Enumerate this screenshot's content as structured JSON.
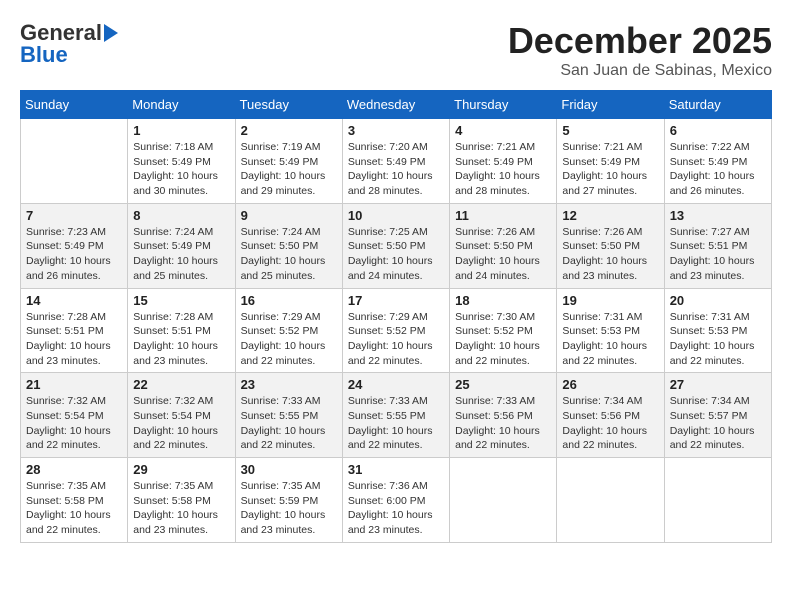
{
  "header": {
    "logo_line1": "General",
    "logo_line2": "Blue",
    "month": "December 2025",
    "location": "San Juan de Sabinas, Mexico"
  },
  "days_of_week": [
    "Sunday",
    "Monday",
    "Tuesday",
    "Wednesday",
    "Thursday",
    "Friday",
    "Saturday"
  ],
  "weeks": [
    [
      {
        "day": "",
        "info": ""
      },
      {
        "day": "1",
        "info": "Sunrise: 7:18 AM\nSunset: 5:49 PM\nDaylight: 10 hours\nand 30 minutes."
      },
      {
        "day": "2",
        "info": "Sunrise: 7:19 AM\nSunset: 5:49 PM\nDaylight: 10 hours\nand 29 minutes."
      },
      {
        "day": "3",
        "info": "Sunrise: 7:20 AM\nSunset: 5:49 PM\nDaylight: 10 hours\nand 28 minutes."
      },
      {
        "day": "4",
        "info": "Sunrise: 7:21 AM\nSunset: 5:49 PM\nDaylight: 10 hours\nand 28 minutes."
      },
      {
        "day": "5",
        "info": "Sunrise: 7:21 AM\nSunset: 5:49 PM\nDaylight: 10 hours\nand 27 minutes."
      },
      {
        "day": "6",
        "info": "Sunrise: 7:22 AM\nSunset: 5:49 PM\nDaylight: 10 hours\nand 26 minutes."
      }
    ],
    [
      {
        "day": "7",
        "info": "Sunrise: 7:23 AM\nSunset: 5:49 PM\nDaylight: 10 hours\nand 26 minutes."
      },
      {
        "day": "8",
        "info": "Sunrise: 7:24 AM\nSunset: 5:49 PM\nDaylight: 10 hours\nand 25 minutes."
      },
      {
        "day": "9",
        "info": "Sunrise: 7:24 AM\nSunset: 5:50 PM\nDaylight: 10 hours\nand 25 minutes."
      },
      {
        "day": "10",
        "info": "Sunrise: 7:25 AM\nSunset: 5:50 PM\nDaylight: 10 hours\nand 24 minutes."
      },
      {
        "day": "11",
        "info": "Sunrise: 7:26 AM\nSunset: 5:50 PM\nDaylight: 10 hours\nand 24 minutes."
      },
      {
        "day": "12",
        "info": "Sunrise: 7:26 AM\nSunset: 5:50 PM\nDaylight: 10 hours\nand 23 minutes."
      },
      {
        "day": "13",
        "info": "Sunrise: 7:27 AM\nSunset: 5:51 PM\nDaylight: 10 hours\nand 23 minutes."
      }
    ],
    [
      {
        "day": "14",
        "info": "Sunrise: 7:28 AM\nSunset: 5:51 PM\nDaylight: 10 hours\nand 23 minutes."
      },
      {
        "day": "15",
        "info": "Sunrise: 7:28 AM\nSunset: 5:51 PM\nDaylight: 10 hours\nand 23 minutes."
      },
      {
        "day": "16",
        "info": "Sunrise: 7:29 AM\nSunset: 5:52 PM\nDaylight: 10 hours\nand 22 minutes."
      },
      {
        "day": "17",
        "info": "Sunrise: 7:29 AM\nSunset: 5:52 PM\nDaylight: 10 hours\nand 22 minutes."
      },
      {
        "day": "18",
        "info": "Sunrise: 7:30 AM\nSunset: 5:52 PM\nDaylight: 10 hours\nand 22 minutes."
      },
      {
        "day": "19",
        "info": "Sunrise: 7:31 AM\nSunset: 5:53 PM\nDaylight: 10 hours\nand 22 minutes."
      },
      {
        "day": "20",
        "info": "Sunrise: 7:31 AM\nSunset: 5:53 PM\nDaylight: 10 hours\nand 22 minutes."
      }
    ],
    [
      {
        "day": "21",
        "info": "Sunrise: 7:32 AM\nSunset: 5:54 PM\nDaylight: 10 hours\nand 22 minutes."
      },
      {
        "day": "22",
        "info": "Sunrise: 7:32 AM\nSunset: 5:54 PM\nDaylight: 10 hours\nand 22 minutes."
      },
      {
        "day": "23",
        "info": "Sunrise: 7:33 AM\nSunset: 5:55 PM\nDaylight: 10 hours\nand 22 minutes."
      },
      {
        "day": "24",
        "info": "Sunrise: 7:33 AM\nSunset: 5:55 PM\nDaylight: 10 hours\nand 22 minutes."
      },
      {
        "day": "25",
        "info": "Sunrise: 7:33 AM\nSunset: 5:56 PM\nDaylight: 10 hours\nand 22 minutes."
      },
      {
        "day": "26",
        "info": "Sunrise: 7:34 AM\nSunset: 5:56 PM\nDaylight: 10 hours\nand 22 minutes."
      },
      {
        "day": "27",
        "info": "Sunrise: 7:34 AM\nSunset: 5:57 PM\nDaylight: 10 hours\nand 22 minutes."
      }
    ],
    [
      {
        "day": "28",
        "info": "Sunrise: 7:35 AM\nSunset: 5:58 PM\nDaylight: 10 hours\nand 22 minutes."
      },
      {
        "day": "29",
        "info": "Sunrise: 7:35 AM\nSunset: 5:58 PM\nDaylight: 10 hours\nand 23 minutes."
      },
      {
        "day": "30",
        "info": "Sunrise: 7:35 AM\nSunset: 5:59 PM\nDaylight: 10 hours\nand 23 minutes."
      },
      {
        "day": "31",
        "info": "Sunrise: 7:36 AM\nSunset: 6:00 PM\nDaylight: 10 hours\nand 23 minutes."
      },
      {
        "day": "",
        "info": ""
      },
      {
        "day": "",
        "info": ""
      },
      {
        "day": "",
        "info": ""
      }
    ]
  ]
}
